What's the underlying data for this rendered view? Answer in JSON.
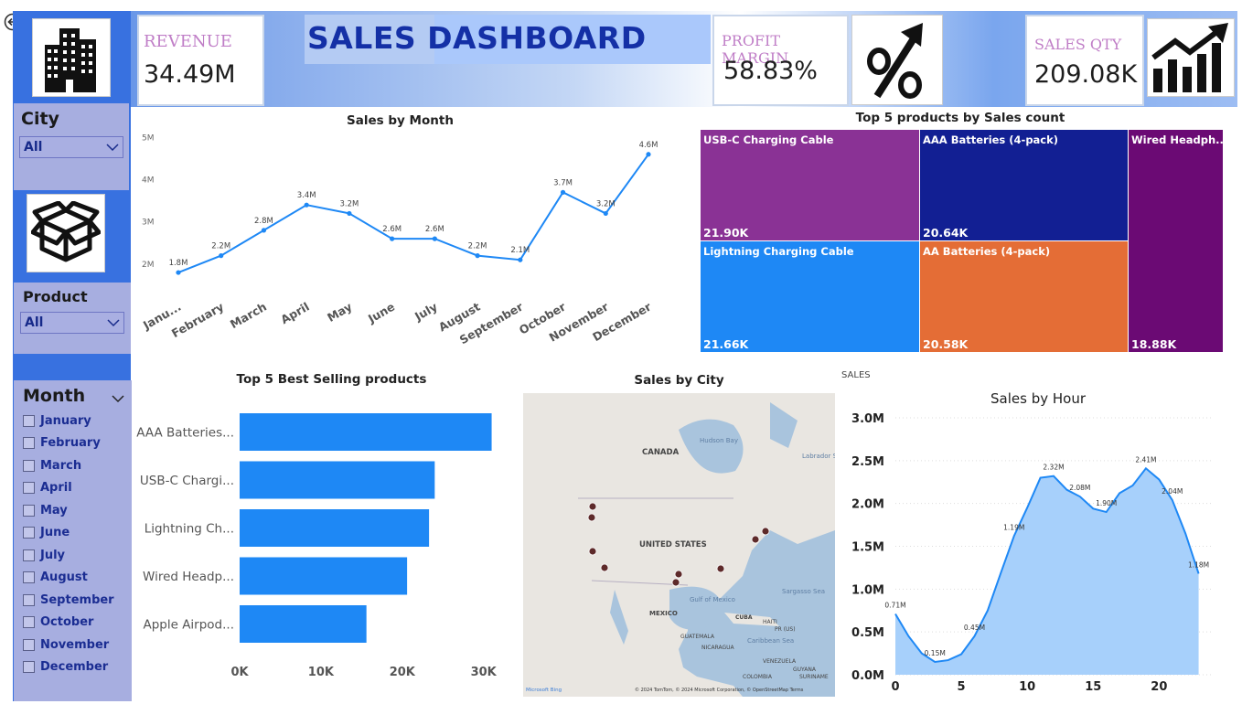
{
  "header": {
    "title": "SALES DASHBOARD",
    "revenue_label": "REVENUE",
    "revenue_value": "34.49M",
    "profit_label": "PROFIT MARGIN",
    "profit_value": "58.83%",
    "qty_label": "SALES QTY",
    "qty_value": "209.08K",
    "icons": [
      "buildings-icon",
      "percent-icon",
      "growth-chart-icon",
      "box-icon"
    ]
  },
  "filters": {
    "city": {
      "label": "City",
      "value": "All"
    },
    "product": {
      "label": "Product",
      "value": "All"
    },
    "month": {
      "label": "Month",
      "options": [
        "January",
        "February",
        "March",
        "April",
        "May",
        "June",
        "July",
        "August",
        "September",
        "October",
        "November",
        "December"
      ]
    }
  },
  "labels": {
    "sales_section": "SALES"
  },
  "colors": {
    "accent": "#1e88f5",
    "treemap": [
      "#8a3295",
      "#121f93",
      "#6b0a74",
      "#1e88f5",
      "#e46d36"
    ]
  },
  "chart_data": [
    {
      "type": "line",
      "title": "Sales by Month",
      "categories": [
        "January",
        "February",
        "March",
        "April",
        "May",
        "June",
        "July",
        "August",
        "September",
        "October",
        "November",
        "December"
      ],
      "display_categories": [
        "Janu...",
        "February",
        "March",
        "April",
        "May",
        "June",
        "July",
        "August",
        "September",
        "October",
        "November",
        "December"
      ],
      "values": [
        1.8,
        2.2,
        2.8,
        3.4,
        3.2,
        2.6,
        2.6,
        2.2,
        2.1,
        3.7,
        3.2,
        4.6
      ],
      "data_labels": [
        "1.8M",
        "2.2M",
        "2.8M",
        "3.4M",
        "3.2M",
        "2.6M",
        "2.6M",
        "2.2M",
        "2.1M",
        "3.7M",
        "3.2M",
        "4.6M"
      ],
      "yticks": [
        "2M",
        "3M",
        "4M",
        "5M"
      ],
      "ylim": [
        1.65,
        5.05
      ],
      "unit": "M"
    },
    {
      "type": "treemap",
      "title": "Top 5 products by Sales count",
      "items": [
        {
          "name": "USB-C Charging Cable",
          "value": "21.90K"
        },
        {
          "name": "AAA Batteries (4-pack)",
          "value": "20.64K"
        },
        {
          "name": "Wired Headph...",
          "value": "18.88K"
        },
        {
          "name": "Lightning Charging Cable",
          "value": "21.66K"
        },
        {
          "name": "AA Batteries (4-pack)",
          "value": "20.58K"
        }
      ]
    },
    {
      "type": "bar",
      "title": "Top 5 Best Selling products",
      "categories": [
        "AAA Batteries...",
        "USB-C Chargi...",
        "Lightning Ch...",
        "Wired Headp...",
        "Apple Airpod..."
      ],
      "values": [
        31000,
        24000,
        23300,
        20600,
        15600
      ],
      "xticks": [
        "0K",
        "10K",
        "20K",
        "30K"
      ],
      "xlim": [
        0,
        31500
      ]
    },
    {
      "type": "map",
      "title": "Sales by City",
      "labels": [
        "CANADA",
        "UNITED STATES",
        "MEXICO",
        "CUBA",
        "Hudson Bay",
        "Labrador S...",
        "Gulf of Mexico",
        "Sargasso Sea",
        "GUATEMALA",
        "NICARAGUA",
        "Caribbean Sea",
        "VENEZUELA",
        "COLOMBIA",
        "GUYANA",
        "SURINAME",
        "HAITI",
        "PR (US)"
      ],
      "attribution": "© 2024 TomTom, © 2024 Microsoft Corporation, © OpenStreetMap  Terms",
      "bing": "Microsoft Bing"
    },
    {
      "type": "area",
      "title": "Sales by Hour",
      "x": [
        0,
        1,
        2,
        3,
        4,
        5,
        6,
        7,
        8,
        9,
        10,
        11,
        12,
        13,
        14,
        15,
        16,
        17,
        18,
        19,
        20,
        21,
        22,
        23
      ],
      "values": [
        0.71,
        0.45,
        0.25,
        0.15,
        0.17,
        0.24,
        0.45,
        0.75,
        1.19,
        1.62,
        1.95,
        2.3,
        2.32,
        2.16,
        2.08,
        1.94,
        1.9,
        2.12,
        2.21,
        2.41,
        2.28,
        2.04,
        1.65,
        1.18
      ],
      "data_labels": {
        "0": "0.71M",
        "3": "0.15M",
        "6": "0.45M",
        "9": "1.19M",
        "12": "2.32M",
        "14": "2.08M",
        "16": "1.90M",
        "19": "2.41M",
        "21": "2.04M",
        "23": "1.18M"
      },
      "yticks": [
        "0.0M",
        "0.5M",
        "1.0M",
        "1.5M",
        "2.0M",
        "2.5M",
        "3.0M"
      ],
      "xticks": [
        "0",
        "5",
        "10",
        "15",
        "20"
      ],
      "ylim": [
        0,
        3.0
      ],
      "xlim": [
        0,
        24
      ]
    }
  ]
}
